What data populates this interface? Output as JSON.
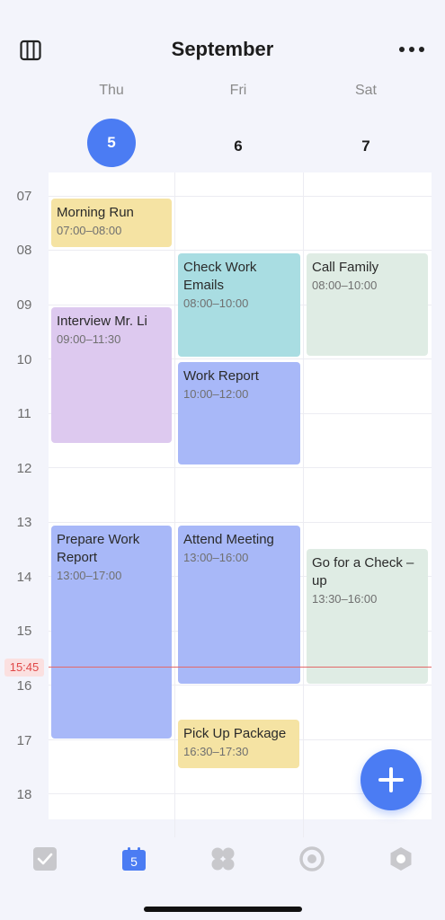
{
  "header": {
    "title": "September",
    "days": [
      {
        "name": "Thu",
        "num": "5"
      },
      {
        "name": "Fri",
        "num": "6"
      },
      {
        "name": "Sat",
        "num": "7"
      }
    ]
  },
  "hours": [
    "07",
    "08",
    "09",
    "10",
    "11",
    "12",
    "13",
    "14",
    "15",
    "16",
    "17",
    "18"
  ],
  "now": "15:45",
  "events": [
    {
      "title": "Morning Run",
      "time": "07:00–08:00"
    },
    {
      "title": "Interview Mr. Li",
      "time": "09:00–11:30"
    },
    {
      "title": "Prepare Work Report",
      "time": "13:00–17:00"
    },
    {
      "title": "Check Work Emails",
      "time": "08:00–10:00"
    },
    {
      "title": "Work Report",
      "time": "10:00–12:00"
    },
    {
      "title": "Attend Meeting",
      "time": "13:00–16:00"
    },
    {
      "title": "Pick Up Package",
      "time": "16:30–17:30"
    },
    {
      "title": "Call Family",
      "time": "08:00–10:00"
    },
    {
      "title": "Go for a Check –up",
      "time": "13:30–16:00"
    }
  ],
  "tabbar": {
    "calendar_day": "5"
  },
  "colors": {
    "accent": "#4b7cf3",
    "yellow": "#f5e3a3",
    "purple": "#ddc9ef",
    "blue": "#a8b8f8",
    "teal": "#a9dde2",
    "green": "#dfece4",
    "now": "#e26a6a"
  }
}
